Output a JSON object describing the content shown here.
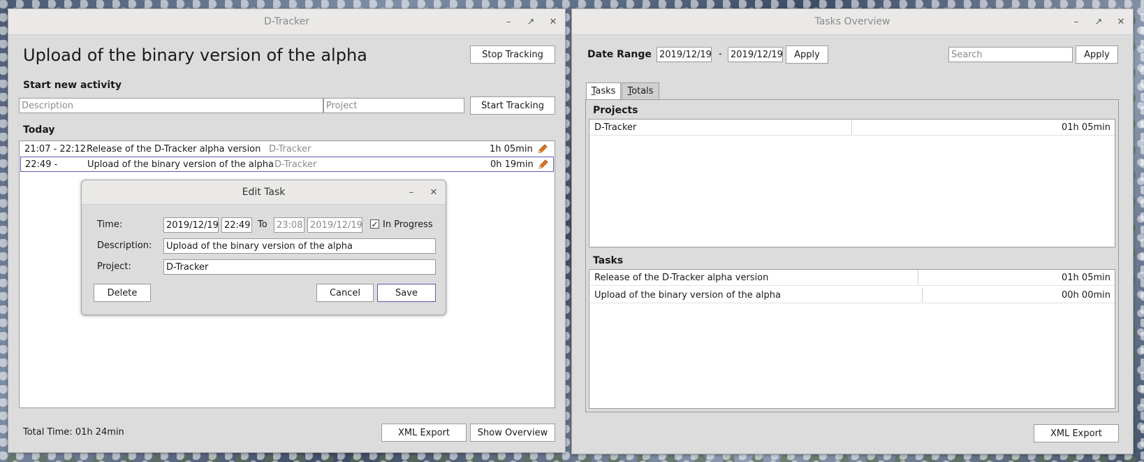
{
  "left_window": {
    "title": "D-Tracker",
    "current_task": "Upload of the binary version of the alpha",
    "stop_tracking": "Stop Tracking",
    "start_new_activity": "Start new activity",
    "description_placeholder": "Description",
    "project_placeholder": "Project",
    "start_tracking": "Start Tracking",
    "today": "Today",
    "activities": [
      {
        "time": "21:07 - 22:12",
        "title": "Release of the D-Tracker alpha version",
        "project": "D-Tracker",
        "duration": "1h 05min"
      },
      {
        "time": "22:49 -",
        "title": "Upload of the binary version of the alpha",
        "project": "D-Tracker",
        "duration": "0h 19min"
      }
    ],
    "total_time": "Total Time: 01h 24min",
    "xml_export": "XML Export",
    "show_overview": "Show Overview"
  },
  "dialog": {
    "title": "Edit Task",
    "time_label": "Time:",
    "start_date": "2019/12/19",
    "start_time": "22:49",
    "to_label": "To",
    "end_time": "23:08",
    "end_date": "2019/12/19",
    "in_progress_label": "In Progress",
    "description_label": "Description:",
    "description_value": "Upload of the binary version of the alpha",
    "project_label": "Project:",
    "project_value": "D-Tracker",
    "delete": "Delete",
    "cancel": "Cancel",
    "save": "Save"
  },
  "right_window": {
    "title": "Tasks Overview",
    "date_range_label": "Date Range",
    "date_from": "2019/12/19",
    "date_sep": "-",
    "date_to": "2019/12/19",
    "apply": "Apply",
    "search_placeholder": "Search",
    "apply_search": "Apply",
    "tabs": [
      {
        "label": "Tasks",
        "mnemonic": "T",
        "rest": "asks"
      },
      {
        "label": "Totals",
        "mnemonic": "T",
        "rest": "otals"
      }
    ],
    "projects_heading": "Projects",
    "projects": [
      {
        "name": "D-Tracker",
        "time": "01h 05min"
      }
    ],
    "tasks_heading": "Tasks",
    "tasks": [
      {
        "name": "Release of the D-Tracker alpha version",
        "time": "01h 05min"
      },
      {
        "name": "Upload of the binary version of the alpha",
        "time": "00h 00min"
      }
    ],
    "xml_export": "XML Export"
  },
  "colors": {
    "window_bg": "#dcdcdc",
    "titlebar_bg": "#eae9e7",
    "selection_border": "#5b5bb0",
    "pencil_orange": "#e8741c"
  }
}
